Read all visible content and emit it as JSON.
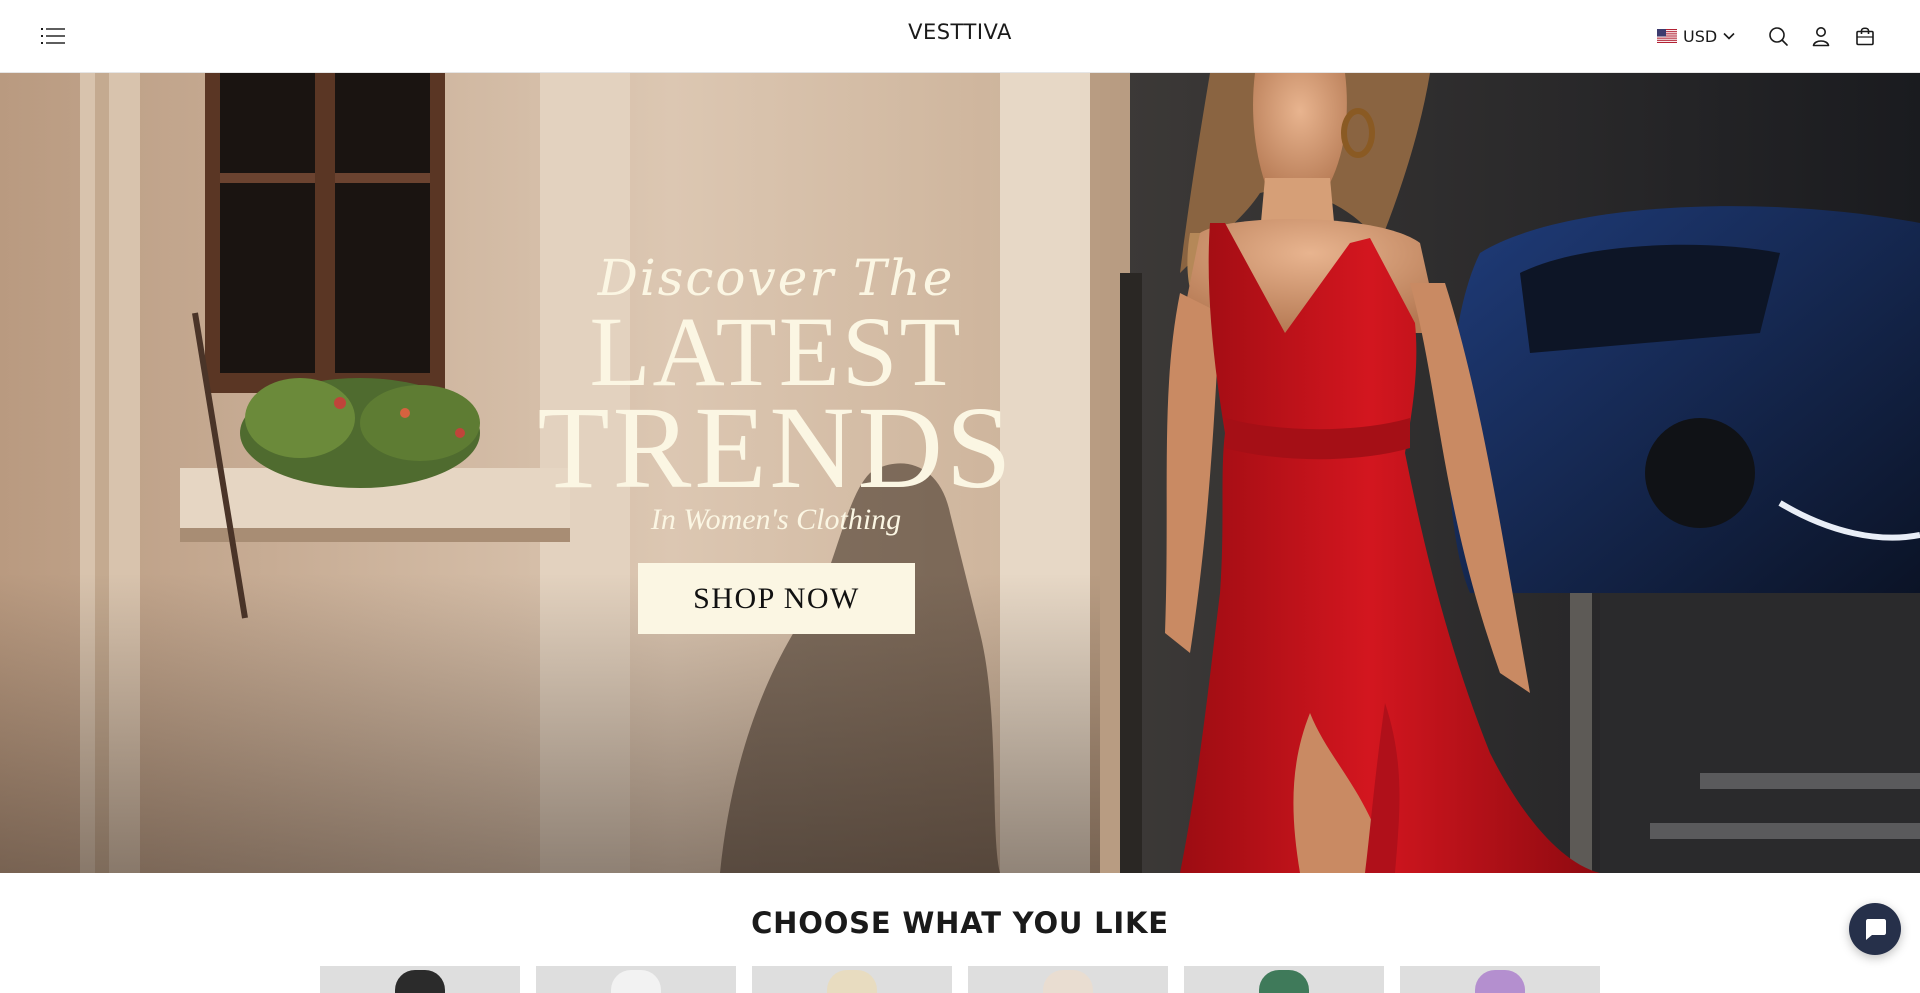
{
  "header": {
    "brand": "VESTTIVA",
    "currency": {
      "code": "USD",
      "flag_icon": "us-flag-icon"
    },
    "icons": [
      "menu-icon",
      "search-icon",
      "account-icon",
      "cart-icon"
    ]
  },
  "hero": {
    "eyebrow": "Discover The",
    "headline_1": "LATEST",
    "headline_2": "TRENDS",
    "subheadline": "In Women's Clothing",
    "cta_label": "SHOP NOW"
  },
  "section": {
    "title": "CHOOSE WHAT YOU LIKE",
    "category_count_visible": 6
  },
  "chat": {
    "icon": "chat-icon"
  },
  "colors": {
    "hero_text": "#fbf6e3",
    "cta_bg": "#fbf6e3",
    "dress": "#c8141c",
    "chat_bg": "#26304a"
  }
}
